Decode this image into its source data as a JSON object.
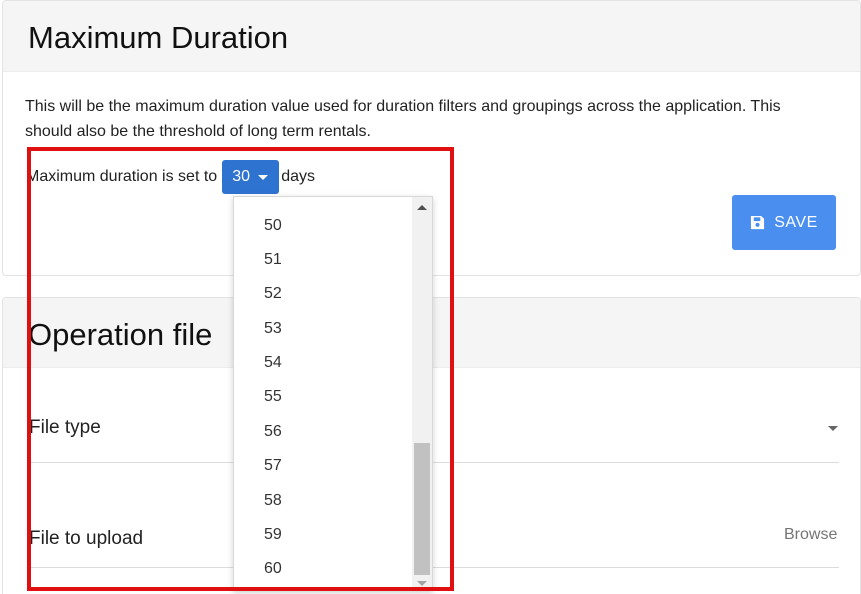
{
  "max_duration": {
    "title": "Maximum Duration",
    "description": "This will be the maximum duration value used for duration filters and groupings across the application. This should also be the threshold of long term rentals.",
    "prefix": "Maximum duration is set to",
    "selected": "30",
    "suffix": "days",
    "save_label": "SAVE",
    "options": [
      "50",
      "51",
      "52",
      "53",
      "54",
      "55",
      "56",
      "57",
      "58",
      "59",
      "60"
    ]
  },
  "operation_file": {
    "title": "Operation file",
    "file_type_label": "File type",
    "file_upload_label": "File to upload",
    "browse_label": "Browse"
  },
  "colors": {
    "select_bg": "#2f73d0",
    "save_bg": "#4a8ef0",
    "highlight": "#e01010"
  },
  "icons": {
    "save": "floppy-disk-icon",
    "select_caret": "caret-down-icon",
    "file_type_caret": "caret-down-icon"
  }
}
